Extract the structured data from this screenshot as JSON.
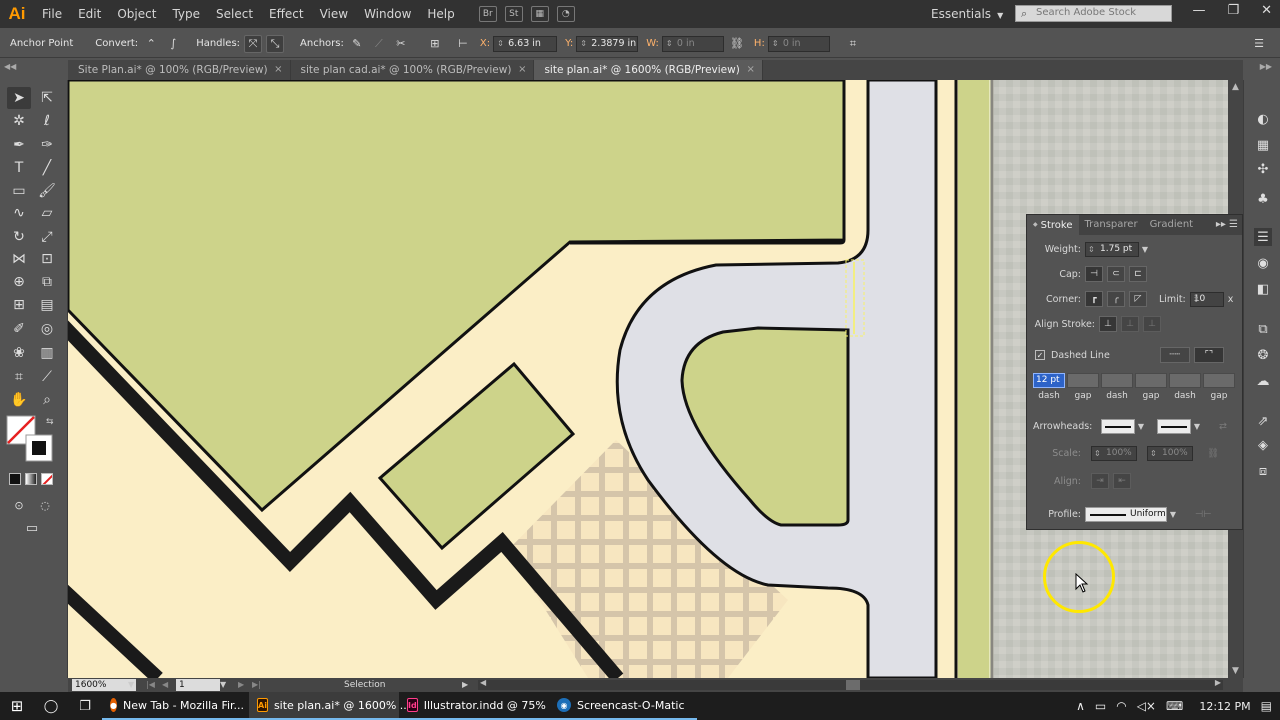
{
  "app": {
    "logo": "Ai"
  },
  "menu": [
    "File",
    "Edit",
    "Object",
    "Type",
    "Select",
    "Effect",
    "View",
    "Window",
    "Help"
  ],
  "menubar_icons": {
    "bridge": "Br",
    "stock": "St"
  },
  "workspace": "Essentials",
  "stock_search_placeholder": "Search Adobe Stock",
  "window_controls": {
    "minimize": "—",
    "restore": "❐",
    "close": "✕"
  },
  "control_bar": {
    "tool_label": "Anchor Point",
    "convert_label": "Convert:",
    "handles_label": "Handles:",
    "anchors_label": "Anchors:",
    "x_label": "X:",
    "x_value": "6.63 in",
    "y_label": "Y:",
    "y_value": "2.3879 in",
    "w_label": "W:",
    "w_value": "0 in",
    "h_label": "H:",
    "h_value": "0 in"
  },
  "tabs": [
    {
      "label": "Site Plan.ai* @ 100% (RGB/Preview)",
      "active": false
    },
    {
      "label": "site plan cad.ai* @ 100% (RGB/Preview)",
      "active": false
    },
    {
      "label": "site plan.ai* @ 1600% (RGB/Preview)",
      "active": true
    }
  ],
  "tab_close": "×",
  "stroke_panel": {
    "tabs": [
      "Stroke",
      "Transparer",
      "Gradient"
    ],
    "weight_label": "Weight:",
    "weight_value": "1.75 pt",
    "cap_label": "Cap:",
    "corner_label": "Corner:",
    "limit_label": "Limit:",
    "limit_value": "10",
    "limit_unit": "x",
    "align_label": "Align Stroke:",
    "dashed_label": "Dashed Line",
    "dashed_checked": true,
    "dash_values": [
      "12 pt",
      "",
      "",
      "",
      "",
      ""
    ],
    "dash_labels": [
      "dash",
      "gap",
      "dash",
      "gap",
      "dash",
      "gap"
    ],
    "arrowheads_label": "Arrowheads:",
    "scale_label": "Scale:",
    "scale_start": "100%",
    "scale_end": "100%",
    "align_arrow_label": "Align:",
    "profile_label": "Profile:",
    "profile_value": "Uniform"
  },
  "status_bar": {
    "zoom": "1600%",
    "page": "1",
    "tool": "Selection"
  },
  "taskbar": {
    "apps": [
      {
        "label": "New Tab - Mozilla Fir...",
        "icon": "firefox-icon"
      },
      {
        "label": "site plan.ai* @ 1600% ...",
        "icon": "illustrator-icon"
      },
      {
        "label": "Illustrator.indd @ 75%",
        "icon": "indesign-icon"
      },
      {
        "label": "Screencast-O-Matic",
        "icon": "screencast-icon"
      }
    ],
    "time": "12:12 PM"
  },
  "colors": {
    "lawn": "#cdd38a",
    "path": "#fbeec6",
    "road": "#dfe0e6",
    "outline": "#111111",
    "accent": "#ff9a00",
    "cursor_highlight": "#ffe800"
  }
}
